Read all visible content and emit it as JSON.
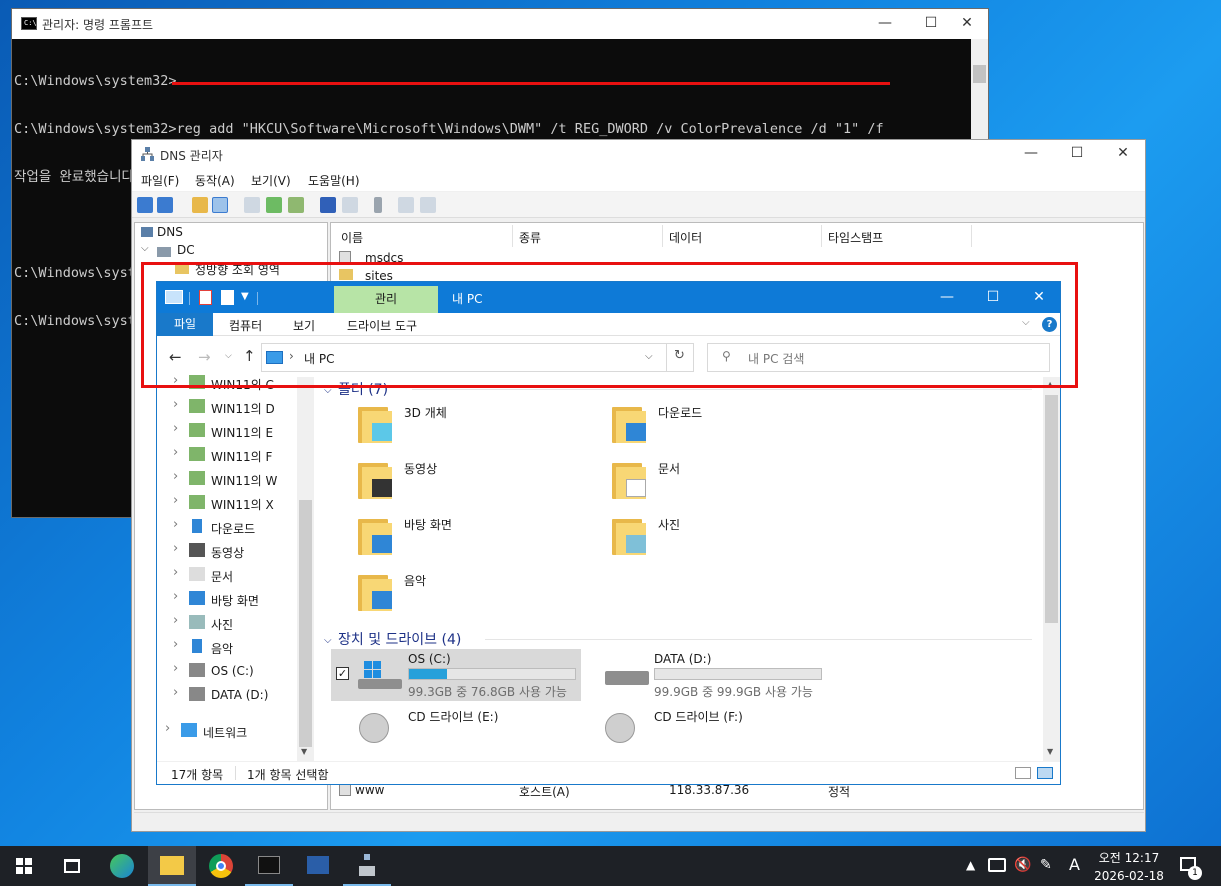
{
  "cmd": {
    "title": "관리자: 명령 프롬프트",
    "icon_text": "C:\\",
    "lines": [
      "C:\\Windows\\system32>",
      "C:\\Windows\\system32>reg add \"HKCU\\Software\\Microsoft\\Windows\\DWM\" /t REG_DWORD /v ColorPrevalence /d \"1\" /f",
      "작업을 완료했습니다.",
      "",
      "C:\\Windows\\system32>",
      "C:\\Windows\\system32>"
    ]
  },
  "dns": {
    "title": "DNS 관리자",
    "menu": [
      "파일(F)",
      "동작(A)",
      "보기(V)",
      "도움말(H)"
    ],
    "tree": {
      "root": "DNS",
      "server": "DC",
      "zone_partial": "정방향 조회 영역"
    },
    "columns": [
      "이름",
      "종류",
      "데이터",
      "타임스탬프"
    ],
    "rows": [
      {
        "name": "_msdcs",
        "type": "",
        "data": "",
        "timestamp": ""
      },
      {
        "name": "_sites",
        "type": "",
        "data": "",
        "timestamp": ""
      },
      {
        "name": "www",
        "type": "호스트(A)",
        "data": "118.33.87.36",
        "timestamp": "정적"
      }
    ]
  },
  "explorer": {
    "title": "내 PC",
    "context_tab": "관리",
    "ribbon_tabs": [
      "파일",
      "컴퓨터",
      "보기",
      "드라이브 도구"
    ],
    "address": "내 PC",
    "search_placeholder": "내 PC 검색",
    "nav": [
      {
        "label": "WIN11의 C",
        "icon": "network-drive-icon"
      },
      {
        "label": "WIN11의 D",
        "icon": "network-drive-icon"
      },
      {
        "label": "WIN11의 E",
        "icon": "network-drive-icon"
      },
      {
        "label": "WIN11의 F",
        "icon": "network-drive-icon"
      },
      {
        "label": "WIN11의 W",
        "icon": "network-drive-icon"
      },
      {
        "label": "WIN11의 X",
        "icon": "network-drive-icon"
      },
      {
        "label": "다운로드",
        "icon": "download-icon"
      },
      {
        "label": "동영상",
        "icon": "video-icon"
      },
      {
        "label": "문서",
        "icon": "document-icon"
      },
      {
        "label": "바탕 화면",
        "icon": "desktop-icon"
      },
      {
        "label": "사진",
        "icon": "picture-icon"
      },
      {
        "label": "음악",
        "icon": "music-icon"
      },
      {
        "label": "OS (C:)",
        "icon": "drive-icon"
      },
      {
        "label": "DATA (D:)",
        "icon": "drive-icon"
      },
      {
        "label": "네트워크",
        "icon": "network-icon"
      }
    ],
    "folders_header": "폴더 (7)",
    "folders": [
      {
        "label": "3D 개체",
        "icon": "3d-objects-icon"
      },
      {
        "label": "다운로드",
        "icon": "download-icon"
      },
      {
        "label": "동영상",
        "icon": "video-icon"
      },
      {
        "label": "문서",
        "icon": "document-icon"
      },
      {
        "label": "바탕 화면",
        "icon": "desktop-icon"
      },
      {
        "label": "사진",
        "icon": "picture-icon"
      },
      {
        "label": "음악",
        "icon": "music-icon"
      }
    ],
    "devices_header": "장치 및 드라이브 (4)",
    "drives": [
      {
        "label": "OS (C:)",
        "free": "99.3GB 중 76.8GB 사용 가능",
        "used_fraction": 0.227,
        "selected": true,
        "icon": "windows-drive-icon"
      },
      {
        "label": "DATA (D:)",
        "free": "99.9GB 중 99.9GB 사용 가능",
        "used_fraction": 0.0,
        "selected": false,
        "icon": "drive-icon"
      },
      {
        "label": "CD 드라이브 (E:)",
        "icon": "cd-drive-icon"
      },
      {
        "label": "CD 드라이브 (F:)",
        "icon": "cd-drive-icon"
      }
    ],
    "status_count": "17개 항목",
    "status_selected": "1개 항목 선택함"
  },
  "taskbar": {
    "time": "오전 12:17",
    "date": "2026-02-18",
    "ime": "A",
    "notification_count": "1"
  },
  "colors": {
    "accent": "#0e7ad7",
    "highlight": "#e81010",
    "context_tab": "#b7e4a6"
  }
}
